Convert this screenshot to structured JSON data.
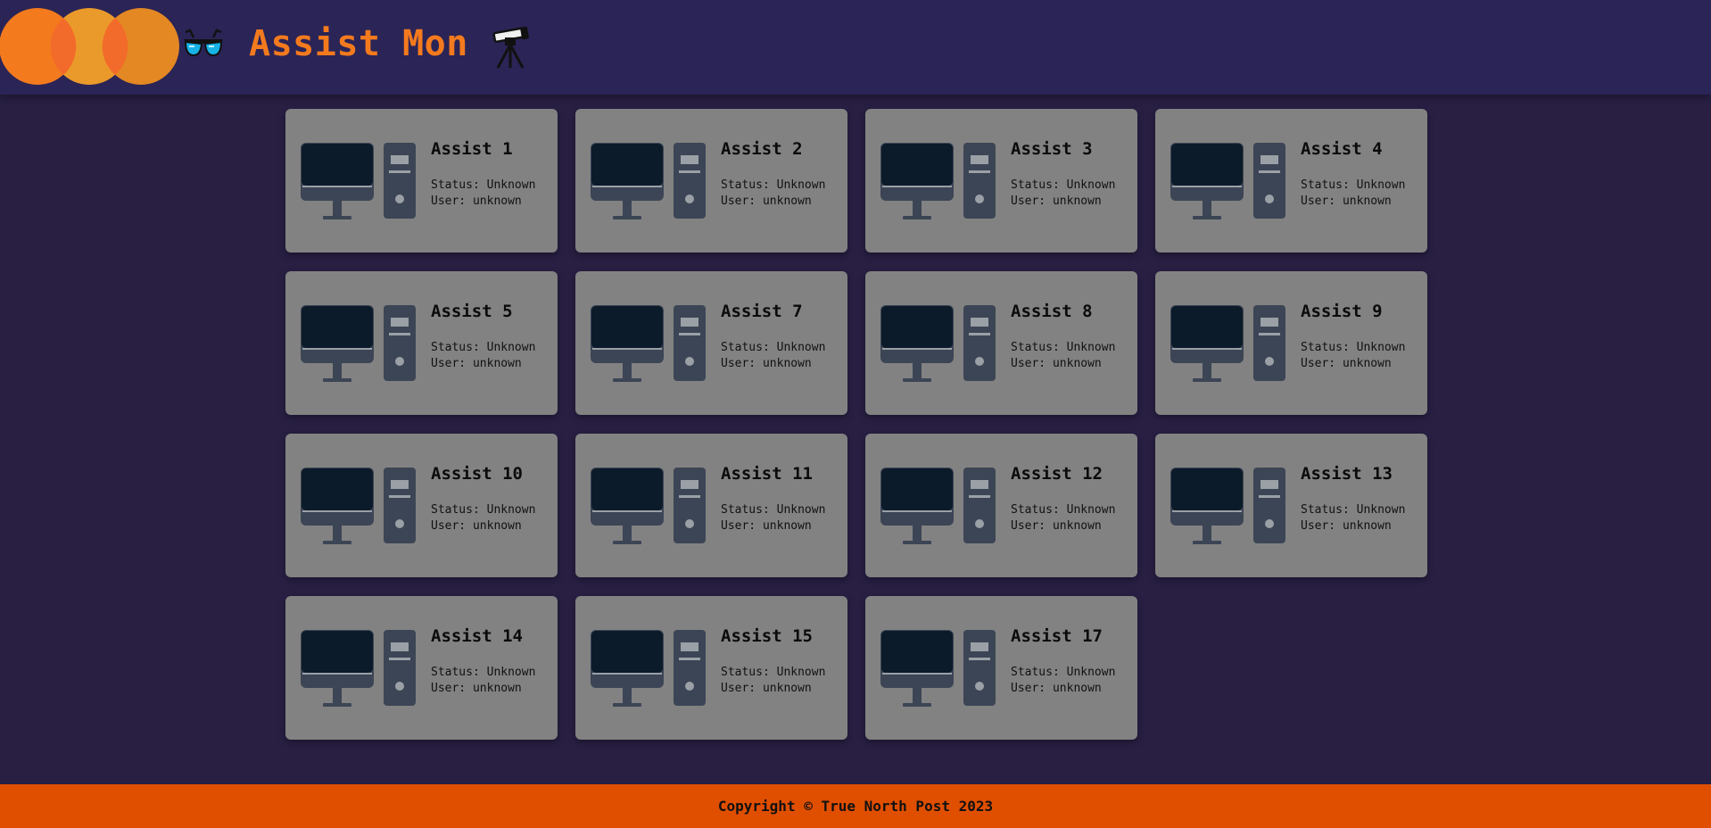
{
  "header": {
    "title": "Assist Mon",
    "glasses_icon": "sunglasses-icon",
    "telescope_icon": "telescope-icon",
    "logo_colors": [
      "#f47a1e",
      "#ffa726",
      "#f26b2a"
    ]
  },
  "machines": [
    {
      "name": "Assist 1",
      "status": "Status: Unknown",
      "user": "User: unknown"
    },
    {
      "name": "Assist 2",
      "status": "Status: Unknown",
      "user": "User: unknown"
    },
    {
      "name": "Assist 3",
      "status": "Status: Unknown",
      "user": "User: unknown"
    },
    {
      "name": "Assist 4",
      "status": "Status: Unknown",
      "user": "User: unknown"
    },
    {
      "name": "Assist 5",
      "status": "Status: Unknown",
      "user": "User: unknown"
    },
    {
      "name": "Assist 7",
      "status": "Status: Unknown",
      "user": "User: unknown"
    },
    {
      "name": "Assist 8",
      "status": "Status: Unknown",
      "user": "User: unknown"
    },
    {
      "name": "Assist 9",
      "status": "Status: Unknown",
      "user": "User: unknown"
    },
    {
      "name": "Assist 10",
      "status": "Status: Unknown",
      "user": "User: unknown"
    },
    {
      "name": "Assist 11",
      "status": "Status: Unknown",
      "user": "User: unknown"
    },
    {
      "name": "Assist 12",
      "status": "Status: Unknown",
      "user": "User: unknown"
    },
    {
      "name": "Assist 13",
      "status": "Status: Unknown",
      "user": "User: unknown"
    },
    {
      "name": "Assist 14",
      "status": "Status: Unknown",
      "user": "User: unknown"
    },
    {
      "name": "Assist 15",
      "status": "Status: Unknown",
      "user": "User: unknown"
    },
    {
      "name": "Assist 17",
      "status": "Status: Unknown",
      "user": "User: unknown"
    }
  ],
  "footer": {
    "text": "Copyright © True North Post 2023"
  },
  "colors": {
    "page_background": "#281f43",
    "header_background": "#2b2456",
    "title": "#f47a1e",
    "card_background": "#828282",
    "computer_icon": "#3c4555",
    "monitor_screen": "#0c1b2a",
    "footer_background": "#e04e00"
  }
}
